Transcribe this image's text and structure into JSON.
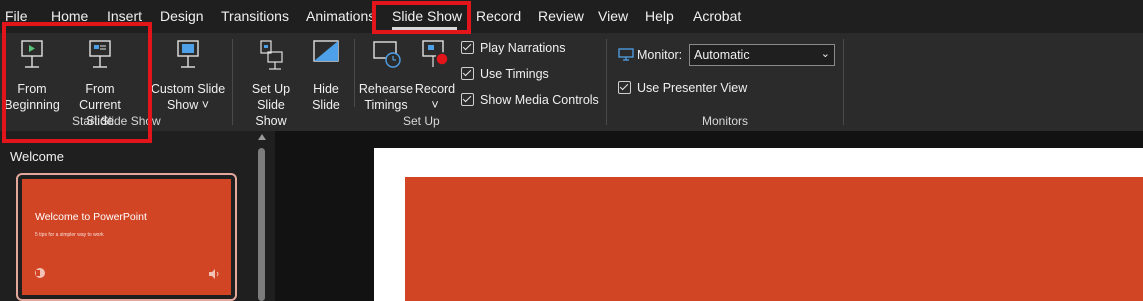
{
  "tabs": [
    "File",
    "Home",
    "Insert",
    "Design",
    "Transitions",
    "Animations",
    "Slide Show",
    "Record",
    "Review",
    "View",
    "Help",
    "Acrobat"
  ],
  "active_tab": "Slide Show",
  "ribbon": {
    "start_group": {
      "label": "Start Slide Show",
      "from_beginning": [
        "From",
        "Beginning"
      ],
      "from_current": [
        "From",
        "Current Slide"
      ],
      "custom_show": [
        "Custom Slide",
        "Show ˅"
      ]
    },
    "setup_group": {
      "label": "Set Up",
      "setup_show": [
        "Set Up",
        "Slide Show"
      ],
      "hide_slide": [
        "Hide",
        "Slide"
      ],
      "rehearse": [
        "Rehearse",
        "Timings"
      ],
      "record": [
        "Record",
        "˅"
      ],
      "play_narrations": "Play Narrations",
      "use_timings": "Use Timings",
      "show_media_controls": "Show Media Controls"
    },
    "monitors_group": {
      "label": "Monitors",
      "monitor_label": "Monitor:",
      "monitor_value": "Automatic",
      "use_presenter_view": "Use Presenter View"
    }
  },
  "pane": {
    "section_title": "Welcome",
    "slide_title": "Welcome to PowerPoint",
    "slide_subtitle": "5 tips for a simpler way to work"
  },
  "colors": {
    "accent_red": "#e1151a",
    "slide_orange": "#d14424"
  }
}
